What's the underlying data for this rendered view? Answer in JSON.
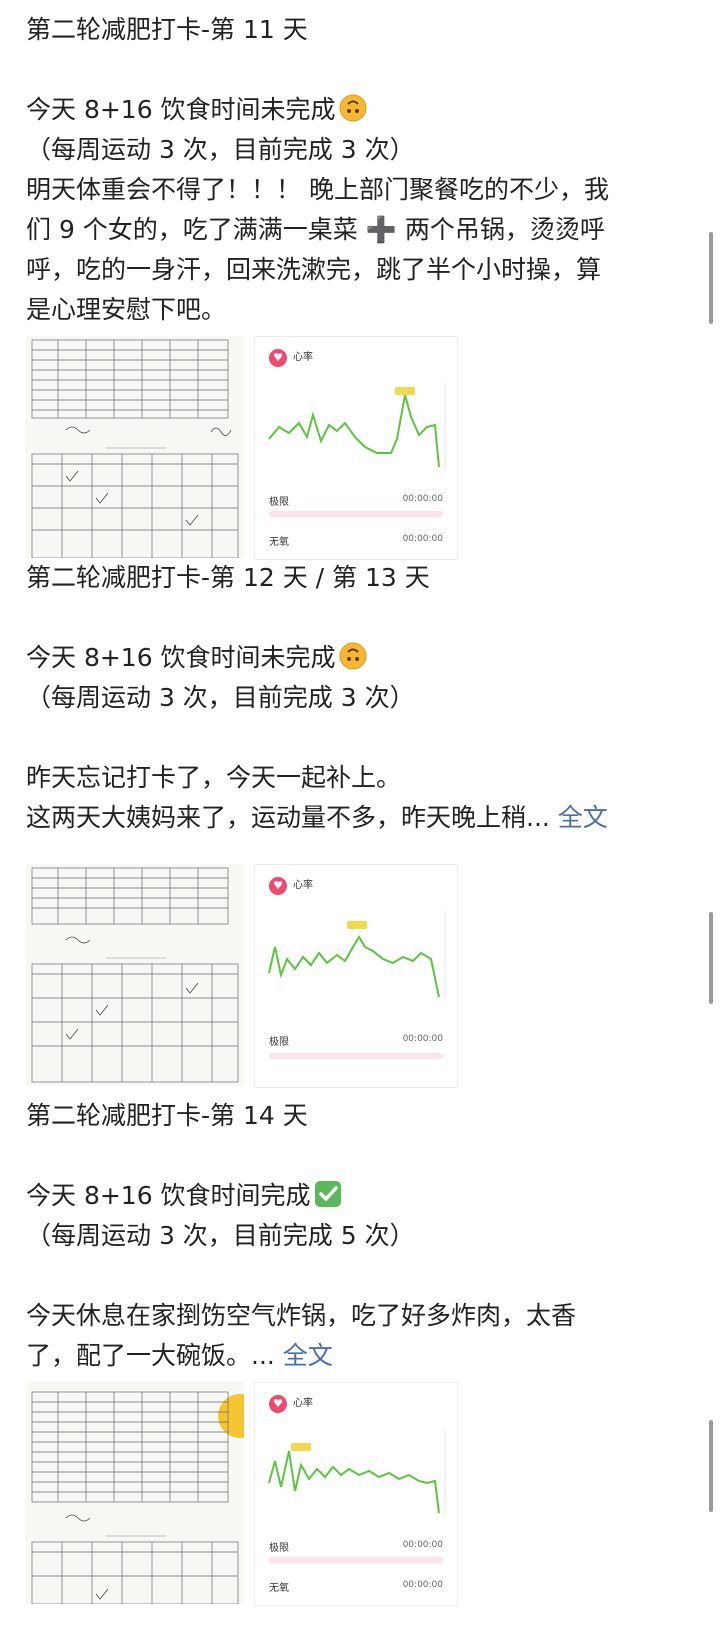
{
  "posts": [
    {
      "title": "第二轮减肥打卡-第 11 天",
      "diet_status": "今天 8+16 饮食时间未完成",
      "diet_emoji": "upside-down-face-emoji",
      "exercise": "（每周运动 3 次，目前完成 3 次）",
      "body_lines": [
        "明天体重会不得了！！！ 晚上部门聚餐吃的不少，我",
        "们 9 个女的，吃了满满一桌菜 ➕ 两个吊锅，烫烫呼",
        "呼，吃的一身汗，回来洗漱完，跳了半个小时操，算",
        "是心理安慰下吧。"
      ],
      "chart": {
        "title": "心率",
        "rows": [
          {
            "label": "极限",
            "time": "00:00:00"
          },
          {
            "label": "无氧",
            "time": "00:00:00"
          }
        ]
      }
    },
    {
      "title": "第二轮减肥打卡-第 12 天 / 第 13 天",
      "diet_status": "今天 8+16 饮食时间未完成",
      "diet_emoji": "upside-down-face-emoji",
      "exercise": "（每周运动 3 次，目前完成 3 次）",
      "body_lines": [
        "昨天忘记打卡了，今天一起补上。",
        "这两天大姨妈来了，运动量不多，昨天晚上稍..."
      ],
      "more_label": "全文",
      "chart": {
        "title": "心率",
        "rows": [
          {
            "label": "极限",
            "time": "00:00:00"
          }
        ]
      }
    },
    {
      "title": "第二轮减肥打卡-第 14 天",
      "diet_status": "今天 8+16 饮食时间完成",
      "diet_emoji": "check-mark-button-emoji",
      "exercise": "（每周运动 3 次，目前完成 5 次）",
      "body_lines": [
        "今天休息在家捯饬空气炸锅，吃了好多炸肉，太香",
        "了，配了一大碗饭。..."
      ],
      "more_label": "全文",
      "chart": {
        "title": "心率",
        "rows": [
          {
            "label": "极限",
            "time": "00:00:00"
          },
          {
            "label": "无氧",
            "time": "00:00:00"
          }
        ]
      }
    }
  ],
  "colors": {
    "text": "#222222",
    "link": "#4a6fa5",
    "heart": "#f04870",
    "line_green": "#5cc53f",
    "peak_yellow": "#f2d84a",
    "zone_bar": "#fde4ea"
  }
}
